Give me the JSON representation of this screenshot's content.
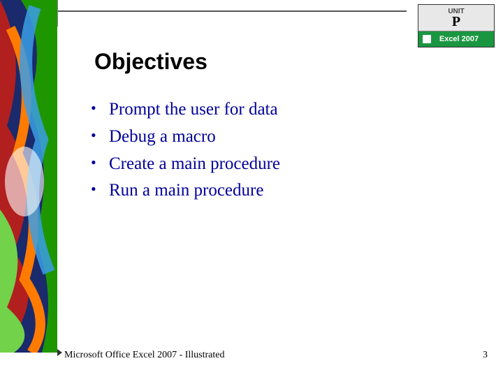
{
  "badge": {
    "unit_label": "UNIT",
    "letter": "P",
    "product": "Excel 2007"
  },
  "title": "Objectives",
  "bullets": [
    "Prompt the user for data",
    "Debug a macro",
    "Create a main procedure",
    "Run a main procedure"
  ],
  "footer": "Microsoft Office Excel 2007 - Illustrated",
  "page_number": "3"
}
